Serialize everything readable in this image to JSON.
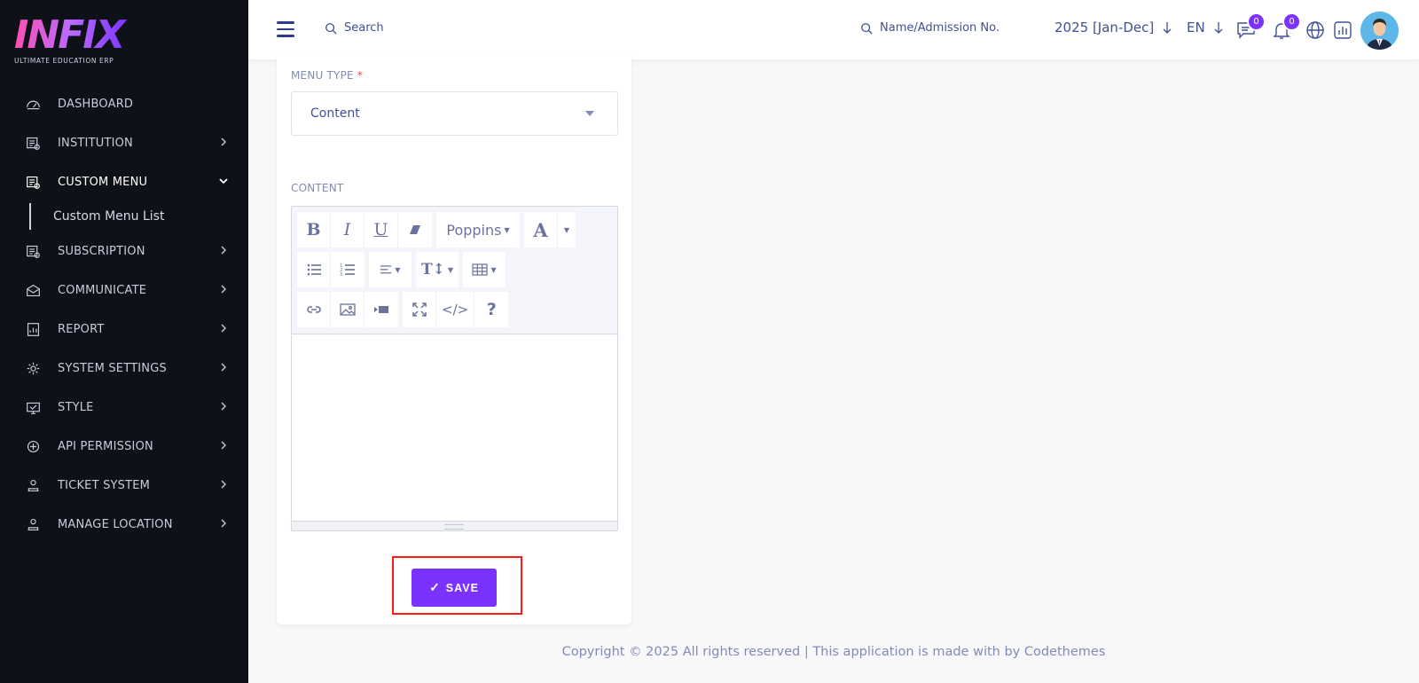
{
  "app": {
    "logo_text": "INFIX",
    "logo_sub": "ULTIMATE EDUCATION ERP"
  },
  "sidebar": {
    "items": [
      {
        "label": "DASHBOARD",
        "icon": "dashboard-icon",
        "chevron": false,
        "active": false
      },
      {
        "label": "INSTITUTION",
        "icon": "institution-icon",
        "chevron": true,
        "active": false
      },
      {
        "label": "CUSTOM MENU",
        "icon": "custom-menu-icon",
        "chevron": true,
        "active": true,
        "expanded": true
      },
      {
        "label": "SUBSCRIPTION",
        "icon": "subscription-icon",
        "chevron": true,
        "active": false
      },
      {
        "label": "COMMUNICATE",
        "icon": "communicate-icon",
        "chevron": true,
        "active": false
      },
      {
        "label": "REPORT",
        "icon": "report-icon",
        "chevron": true,
        "active": false
      },
      {
        "label": "SYSTEM SETTINGS",
        "icon": "gear-icon",
        "chevron": true,
        "active": false
      },
      {
        "label": "STYLE",
        "icon": "style-icon",
        "chevron": true,
        "active": false
      },
      {
        "label": "API PERMISSION",
        "icon": "api-icon",
        "chevron": true,
        "active": false
      },
      {
        "label": "TICKET SYSTEM",
        "icon": "ticket-icon",
        "chevron": true,
        "active": false
      },
      {
        "label": "MANAGE LOCATION",
        "icon": "location-icon",
        "chevron": true,
        "active": false
      }
    ],
    "sub_item": "Custom Menu List"
  },
  "header": {
    "search_label": "Search",
    "admission_search": "Name/Admission No.",
    "year": "2025 [Jan-Dec]",
    "language": "EN",
    "chat_count": "0",
    "notification_count": "0"
  },
  "form": {
    "menu_type_label": "MENU TYPE",
    "required_mark": "*",
    "menu_type_value": "Content",
    "content_label": "CONTENT",
    "font_name": "Poppins",
    "save_label": "SAVE",
    "save_check": "✓"
  },
  "footer": {
    "text": "Copyright © 2025 All rights reserved | This application is made with by Codethemes"
  },
  "colors": {
    "accent": "#7c32ff",
    "sidebar_bg": "#0f1118",
    "highlight": "#ff1a1a"
  }
}
